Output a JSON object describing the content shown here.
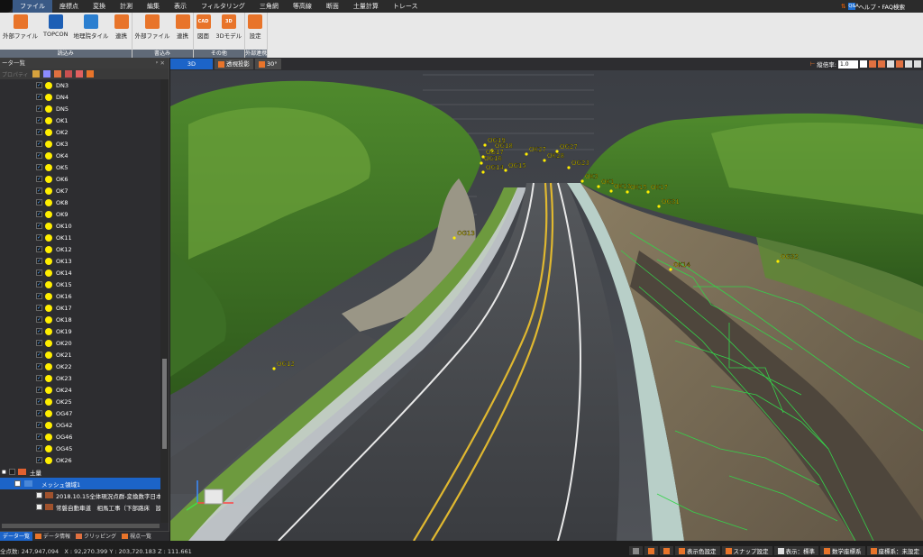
{
  "menu": [
    "ファイル",
    "座標点",
    "変換",
    "計測",
    "編集",
    "表示",
    "フィルタリング",
    "三角網",
    "等高線",
    "断面",
    "土量計算",
    "トレース"
  ],
  "help": {
    "label": "ヘルプ・FAQ検索",
    "badge": "Q&A"
  },
  "ribbon": {
    "groups": [
      {
        "name": "読込み",
        "buttons": [
          {
            "label": "外部ファイル",
            "icon": "file-icon",
            "color": "#e8742a"
          },
          {
            "label": "TOPCON",
            "icon": "topcon-icon",
            "color": "#1d5fb5"
          },
          {
            "label": "地理院タイル",
            "icon": "tile-icon",
            "color": "#2b7fd0"
          },
          {
            "label": "連携",
            "icon": "link-icon",
            "color": "#e8742a"
          }
        ]
      },
      {
        "name": "書込み",
        "buttons": [
          {
            "label": "外部ファイル",
            "icon": "file-export-icon",
            "color": "#e8742a"
          },
          {
            "label": "連携",
            "icon": "link-export-icon",
            "color": "#e8742a"
          }
        ]
      },
      {
        "name": "その他",
        "buttons": [
          {
            "label": "図面",
            "icon": "cad-icon",
            "color": "#e8742a",
            "text": "CAD"
          },
          {
            "label": "3Dモデル",
            "icon": "3d-model-icon",
            "color": "#e8742a",
            "text": "3D"
          }
        ]
      },
      {
        "name": "外部連携",
        "buttons": [
          {
            "label": "設定",
            "icon": "gear-icon",
            "color": "#e8742a"
          }
        ]
      }
    ]
  },
  "panel": {
    "title": "ータ一覧",
    "toolbar_label": "プロパティ",
    "points": [
      "DN3",
      "DN4",
      "DN5",
      "OK1",
      "OK2",
      "OK3",
      "OK4",
      "OK5",
      "OK6",
      "OK7",
      "OK8",
      "OK9",
      "OK10",
      "OK11",
      "OK12",
      "OK13",
      "OK14",
      "OK15",
      "OK16",
      "OK17",
      "OK18",
      "OK19",
      "OK20",
      "OK21",
      "OK22",
      "OK23",
      "OK24",
      "OK25",
      "OG47",
      "OG42",
      "OG46",
      "OG45",
      "OK26"
    ],
    "volume_group": "土量",
    "mesh_item": "メッシュ領域1",
    "layers": [
      {
        "label": "2018.10.15全体現況点群-変換数字日本測",
        "color": "#a0522d"
      },
      {
        "label": "常磐自動車道　相馬工事（下部路床　設",
        "color": "#a0522d"
      }
    ],
    "tabs": [
      "データ一覧",
      "データ情報",
      "クリッピング",
      "視点一覧"
    ]
  },
  "viewtabs": [
    {
      "label": "3D",
      "active": true
    },
    {
      "label": "透視投影",
      "active": false
    },
    {
      "label": "30°",
      "active": false
    }
  ],
  "viewtools": {
    "label": "縦倍率:",
    "value": "1.0"
  },
  "scene": {
    "labels": [
      {
        "t": "OG19"
      },
      {
        "t": "OG18"
      },
      {
        "t": "OG17"
      },
      {
        "t": "OG16"
      },
      {
        "t": "OG15"
      },
      {
        "t": "OG14"
      },
      {
        "t": "OG13"
      },
      {
        "t": "OG12"
      },
      {
        "t": "OG31"
      },
      {
        "t": "OG32"
      },
      {
        "t": "OK14"
      },
      {
        "t": "OK27"
      },
      {
        "t": "OK28"
      },
      {
        "t": "OK3"
      },
      {
        "t": "OK1"
      },
      {
        "t": "OG27"
      },
      {
        "t": "OG23"
      },
      {
        "t": "OK13"
      },
      {
        "t": "OK15"
      },
      {
        "t": "OK17"
      }
    ]
  },
  "status": {
    "point_count": "全点数: 247,947,094",
    "coords": "X : 92,270.399  Y : 203,720.183  Z : 111.661",
    "buttons": [
      "表示色設定",
      "スナップ設定",
      "表示：標準",
      "数学座標系",
      "座標系：未設定"
    ]
  }
}
